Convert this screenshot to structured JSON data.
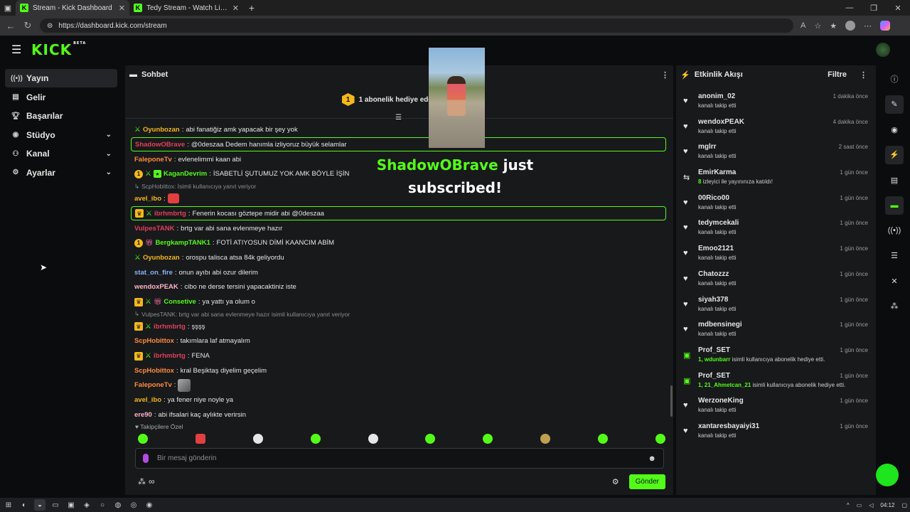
{
  "browser": {
    "tabs": [
      {
        "title": "Stream - Kick Dashboard",
        "active": true
      },
      {
        "title": "Tedy Stream - Watch Live on Kick",
        "active": false
      }
    ],
    "url": "https://dashboard.kick.com/stream"
  },
  "header": {
    "logo": "KICK",
    "beta": "BETA"
  },
  "sidebar": {
    "items": [
      {
        "label": "Yayın",
        "icon": "broadcast-icon",
        "active": true,
        "expandable": false
      },
      {
        "label": "Gelir",
        "icon": "revenue-icon",
        "active": false,
        "expandable": false
      },
      {
        "label": "Başarılar",
        "icon": "trophy-icon",
        "active": false,
        "expandable": false
      },
      {
        "label": "Stüdyo",
        "icon": "studio-icon",
        "active": false,
        "expandable": true
      },
      {
        "label": "Kanal",
        "icon": "channel-icon",
        "active": false,
        "expandable": true
      },
      {
        "label": "Ayarlar",
        "icon": "settings-icon",
        "active": false,
        "expandable": true
      }
    ]
  },
  "chat": {
    "title": "Sohbet",
    "pinned": {
      "badge": "1",
      "text": "1 abonelik hediye ederek 1. s"
    },
    "messages": [
      {
        "user": "Oyunbozan",
        "color": "#f4b81d",
        "badges": [
          "sword"
        ],
        "text": "abi fanatiğiz amk yapacak bir şey yok"
      },
      {
        "user": "ShadowOBrave",
        "color": "#e0405a",
        "badges": [],
        "text": "@0deszaa Dedem hanımla izliyoruz büyük selamlar",
        "highlight": true
      },
      {
        "user": "FaleponeTv",
        "color": "#ff8c42",
        "badges": [],
        "text": "evlenelimmi kaan abi"
      },
      {
        "user": "KaganDevrim",
        "color": "#53fc18",
        "badges": [
          "num",
          "sword",
          "sub"
        ],
        "text": "İSABETLİ ŞUTUMUZ YOK AMK BÖYLE İŞİN"
      },
      {
        "reply": true,
        "text": "ScpHobittox:  İsimli kullanıcıya yanıt veriyor"
      },
      {
        "user": "avel_ibo",
        "color": "#f4b81d",
        "badges": [],
        "text": "",
        "emote": "red"
      },
      {
        "user": "ibrhmbrtg",
        "color": "#e0405a",
        "badges": [
          "crown",
          "sword"
        ],
        "text": "Fenerin kocası göztepe midir abi @0deszaa",
        "highlight": true
      },
      {
        "user": "VulpesTANK",
        "color": "#e0405a",
        "badges": [],
        "text": "brtg var abi sana evlenmeye hazır"
      },
      {
        "user": "BergkampTANK1",
        "color": "#53fc18",
        "badges": [
          "num",
          "gift"
        ],
        "text": "FOTİ ATIYOSUN DİMİ KAANCIM ABİM"
      },
      {
        "user": "Oyunbozan",
        "color": "#f4b81d",
        "badges": [
          "sword"
        ],
        "text": "orospu talisca atsa 84k geliyordu"
      },
      {
        "user": "stat_on_fire",
        "color": "#8ab4f8",
        "badges": [],
        "text": "onun ayıbı abi ozur dilerim"
      },
      {
        "user": "wendoxPEAK",
        "color": "#ffb4c8",
        "badges": [],
        "text": "cibo ne derse tersini yapacaktiniz iste"
      },
      {
        "user": "Consetive",
        "color": "#53fc18",
        "badges": [
          "crown",
          "sword",
          "gift"
        ],
        "text": "ya yattı ya olum o"
      },
      {
        "reply": true,
        "text": "VulpesTANK: brtg var abi sana evlenmeye hazır isimli kullanıcıya yanıt veriyor"
      },
      {
        "user": "ibrhmbrtg",
        "color": "#e0405a",
        "badges": [
          "crown",
          "sword"
        ],
        "text": "şşşş"
      },
      {
        "user": "ScpHobittox",
        "color": "#ff8c42",
        "badges": [],
        "text": "takımlara laf atmayalım"
      },
      {
        "user": "ibrhmbrtg",
        "color": "#e0405a",
        "badges": [
          "crown",
          "sword"
        ],
        "text": "FENA"
      },
      {
        "user": "ScpHobittox",
        "color": "#ff8c42",
        "badges": [],
        "text": "kral Beşiktaş diyelim geçelim"
      },
      {
        "user": "FaleponeTv",
        "color": "#ff8c42",
        "badges": [],
        "text": "",
        "emote": "img"
      },
      {
        "user": "avel_ibo",
        "color": "#f4b81d",
        "badges": [],
        "text": "ya fener niye noyle ya"
      },
      {
        "user": "ere90",
        "color": "#ffb4c8",
        "badges": [],
        "text": "abi ifsalari kaç aylıkte verirsin"
      }
    ],
    "followers_label": "Takipçilere Özel",
    "input_placeholder": "Bir mesaj gönderin",
    "send_label": "Gönder"
  },
  "overlay": {
    "alert_name": "ShadowOBrave",
    "alert_text": "just subscribed!"
  },
  "activity": {
    "title": "Etkinlik Akışı",
    "filter_label": "Filtre",
    "items": [
      {
        "name": "anonim_02",
        "desc": "kanalı takip etti",
        "time": "1 dakika önce",
        "type": "follow"
      },
      {
        "name": "wendoxPEAK",
        "desc": "kanalı takip etti",
        "time": "4 dakika önce",
        "type": "follow"
      },
      {
        "name": "mglrr",
        "desc": "kanalı takip etti",
        "time": "2 saat önce",
        "type": "follow"
      },
      {
        "name": "EmirKarma",
        "desc_hl": "8",
        "desc": " izleyici ile yayınınıza katıldı!",
        "time": "1 gün önce",
        "type": "raid"
      },
      {
        "name": "00Rico00",
        "desc": "kanalı takip etti",
        "time": "1 gün önce",
        "type": "follow"
      },
      {
        "name": "tedymcekali",
        "desc": "kanalı takip etti",
        "time": "1 gün önce",
        "type": "follow"
      },
      {
        "name": "Emoo2121",
        "desc": "kanalı takip etti",
        "time": "1 gün önce",
        "type": "follow"
      },
      {
        "name": "Chatozzz",
        "desc": "kanalı takip etti",
        "time": "1 gün önce",
        "type": "follow"
      },
      {
        "name": "siyah378",
        "desc": "kanalı takip etti",
        "time": "1 gün önce",
        "type": "follow"
      },
      {
        "name": "mdbensinegi",
        "desc": "kanalı takip etti",
        "time": "1 gün önce",
        "type": "follow"
      },
      {
        "name": "Prof_SET",
        "desc_hl": "1, wdunbarr",
        "desc": " isimli kullanıcıya abonelik hediye etti.",
        "time": "1 gün önce",
        "type": "gift"
      },
      {
        "name": "Prof_SET",
        "desc_hl": "1, 21_Ahmetcan_21",
        "desc": " isimli kullanıcıya abonelik hediye etti.",
        "time": "1 gün önce",
        "type": "gift"
      },
      {
        "name": "WerzoneKing",
        "desc": "kanalı takip etti",
        "time": "1 gün önce",
        "type": "follow"
      },
      {
        "name": "xantaresbayaiyi31",
        "desc": "kanalı takip etti",
        "time": "1 gün önce",
        "type": "follow"
      }
    ]
  },
  "taskbar": {
    "time": "04:12"
  }
}
